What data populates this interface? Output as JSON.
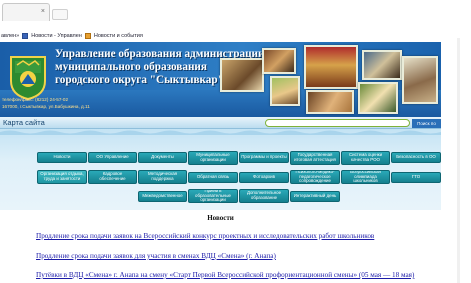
{
  "browser": {
    "tab_title": "",
    "tab_close": "×",
    "bookmarks": [
      "авлен»",
      "Новости - Управлен",
      "Новости и события"
    ]
  },
  "header": {
    "title_lines": [
      "Управление образования администрации",
      "муниципального образования",
      "городского округа \"Сыктывкар\""
    ],
    "phone": "телефон/факс: (8212) 24-57-02",
    "address": "167000, г.Сыктывкар, ул.Бабушкина, д.11"
  },
  "sitebar": {
    "sitemap_label": "Карта сайта",
    "search_placeholder": "",
    "search_button": "Поиск по сайту"
  },
  "nav": {
    "buttons": [
      "Новости",
      "ОО Управление",
      "Документы",
      "Муниципальные организации",
      "Программы и проекты",
      "Государственная итоговая аттестация",
      "Система оценки качества РОО",
      "Безопасность в ОО",
      "Организация отдыха, труда и занятости",
      "Кадровое обеспечение",
      "Методическая поддержка",
      "Обратная связь",
      "Фотоархив",
      "Психолого-медико-педагогическое сопровождение",
      "Всероссийская олимпиада школьников",
      "ГТО",
      "Межведомственное",
      "Приём в образовательные организации",
      "Дополнительное образование",
      "Интерактивный день"
    ]
  },
  "news": {
    "title": "Новости",
    "items": [
      "Продление срока подачи заявок на Всероссийский конкурс проектных и исследовательских работ школьников",
      "Продление срока подачи заявок для участия в сменах ВДЦ «Смена» (г. Анапа)",
      "Путёвки в ВДЦ «Смена» г. Анапа на смену «Старт Первой Всероссийской профориентационной смены» (05 мая — 18 мая)"
    ]
  },
  "colors": {
    "header_blue": "#1a5ea8",
    "nav_teal": "#15808e",
    "link": "#1b1ba8"
  }
}
